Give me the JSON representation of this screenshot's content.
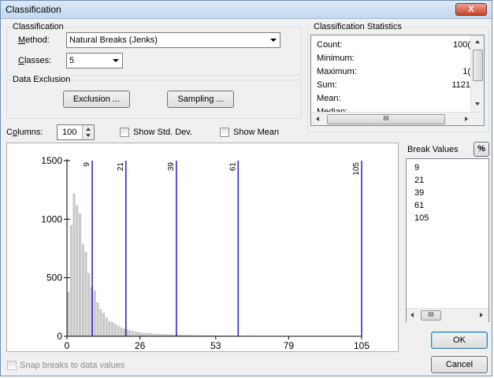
{
  "window": {
    "title": "Classification",
    "close_label": "X"
  },
  "classification": {
    "group_label": "Classification",
    "method_label": "Method:",
    "method_value": "Natural Breaks (Jenks)",
    "classes_label": "Classes:",
    "classes_value": "5"
  },
  "data_exclusion": {
    "group_label": "Data Exclusion",
    "exclusion_button": "Exclusion ...",
    "sampling_button": "Sampling ..."
  },
  "statistics": {
    "group_label": "Classification Statistics",
    "rows": [
      {
        "key": "Count:",
        "value": "100("
      },
      {
        "key": "Minimum:",
        "value": ""
      },
      {
        "key": "Maximum:",
        "value": "1("
      },
      {
        "key": "Sum:",
        "value": "1121"
      },
      {
        "key": "Mean:",
        "value": ""
      },
      {
        "key": "Median:",
        "value": ""
      }
    ],
    "hscroll_grip": "III"
  },
  "columns": {
    "label": "Columns:",
    "value": "100",
    "show_std_dev_label": "Show Std. Dev.",
    "show_mean_label": "Show Mean",
    "show_std_dev": false,
    "show_mean": false
  },
  "break_values": {
    "label": "Break Values",
    "percent_button": "%",
    "values": [
      "9",
      "21",
      "39",
      "61",
      "105"
    ],
    "hscroll_grip": "III"
  },
  "buttons": {
    "ok": "OK",
    "cancel": "Cancel"
  },
  "snap": {
    "label": "Snap breaks to data values",
    "checked": false,
    "enabled": false
  },
  "colors": {
    "bar": "#c8c8c8",
    "break_line": "#2020c8",
    "accent": "#6d8fb3"
  },
  "chart_data": {
    "type": "bar",
    "title": "",
    "xlabel": "",
    "ylabel": "",
    "xlim": [
      0,
      105
    ],
    "ylim": [
      0,
      1500
    ],
    "x_ticks": [
      "0",
      "26",
      "53",
      "79",
      "105"
    ],
    "y_ticks": [
      "0",
      "500",
      "1000",
      "1500"
    ],
    "bin_width": 1.05,
    "values": [
      380,
      950,
      1220,
      1120,
      1050,
      790,
      720,
      540,
      420,
      390,
      290,
      230,
      200,
      160,
      130,
      120,
      105,
      90,
      75,
      65,
      58,
      52,
      45,
      40,
      36,
      32,
      30,
      28,
      26,
      24,
      22,
      20,
      19,
      18,
      17,
      16,
      15,
      14,
      13,
      12,
      11,
      11,
      10,
      10,
      9,
      9,
      8,
      8,
      8,
      7,
      7,
      7,
      6,
      6,
      6,
      5,
      5,
      5,
      5,
      4,
      4,
      4,
      4,
      3,
      3,
      3,
      3,
      3,
      3,
      2,
      2,
      2,
      2,
      2,
      2,
      2,
      2,
      1,
      1,
      1,
      1,
      1,
      1,
      1,
      1,
      1,
      1,
      1,
      1,
      0,
      0,
      0,
      0,
      0,
      0,
      0,
      0,
      0,
      0,
      0
    ],
    "breaks": [
      9,
      21,
      39,
      61,
      105
    ],
    "break_labels": [
      "9",
      "21",
      "39",
      "61",
      "105"
    ]
  }
}
